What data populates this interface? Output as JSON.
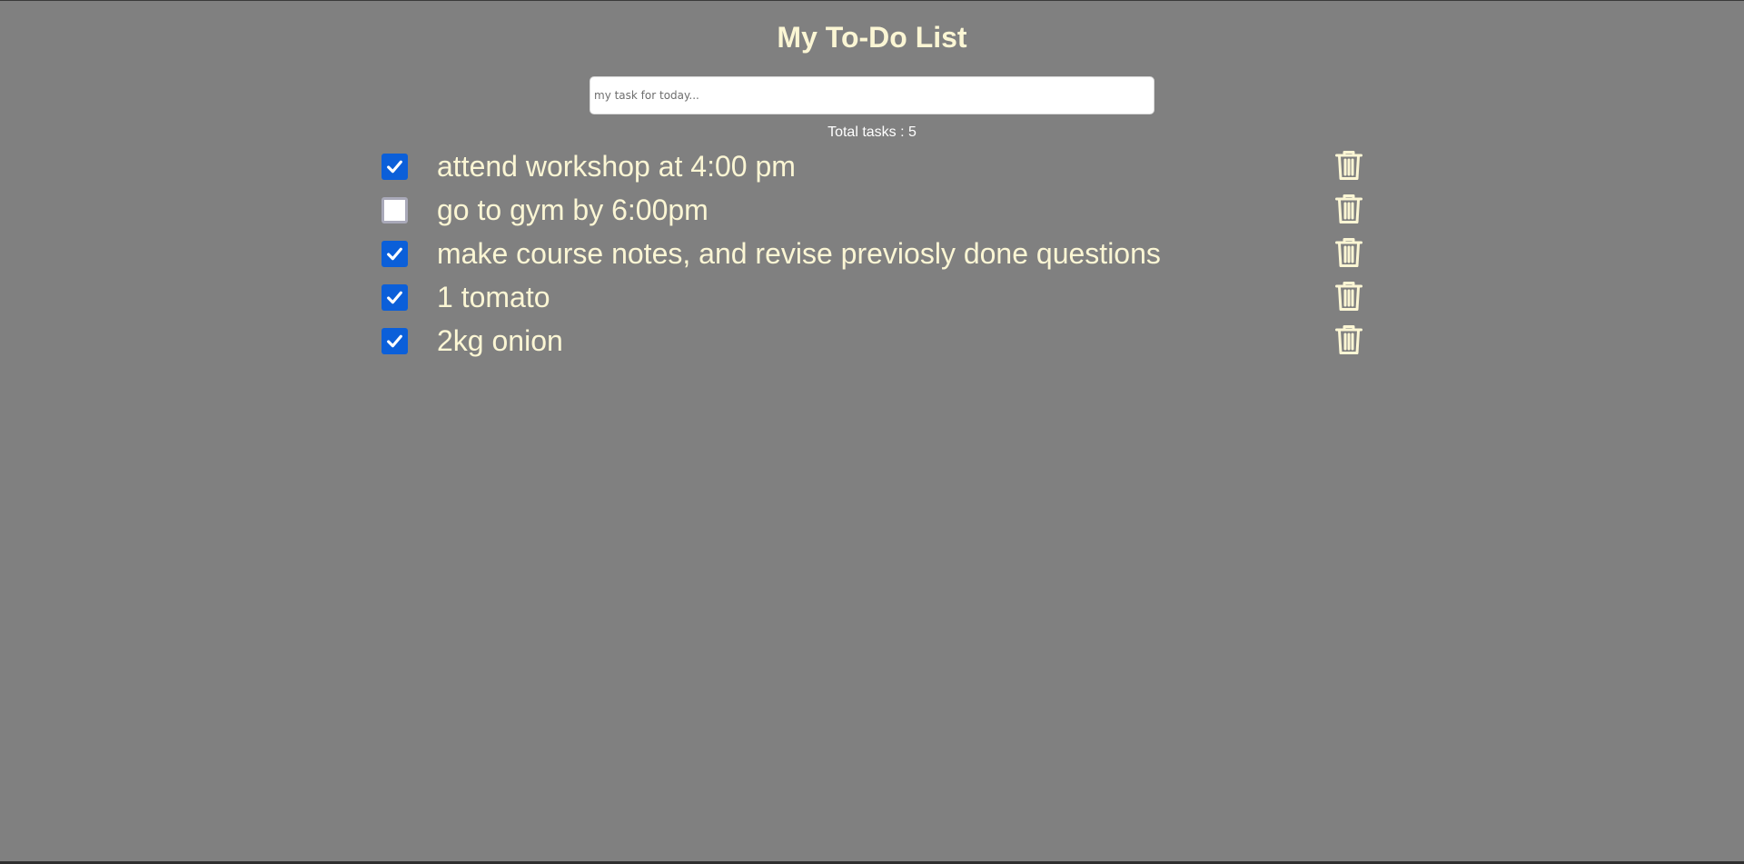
{
  "header": {
    "title": "My To-Do List"
  },
  "task_input": {
    "placeholder": "my task for today...",
    "value": ""
  },
  "summary": {
    "total_label": "Total tasks : 5"
  },
  "tasks": [
    {
      "text": "attend workshop at 4:00 pm",
      "checked": true
    },
    {
      "text": "go to gym by 6:00pm",
      "checked": false
    },
    {
      "text": "make course notes, and revise previosly done questions",
      "checked": true
    },
    {
      "text": "1 tomato",
      "checked": true
    },
    {
      "text": "2kg onion",
      "checked": true
    }
  ],
  "icons": {
    "delete": "trash-icon",
    "checkmark": "checkmark-icon"
  },
  "colors": {
    "background": "#808080",
    "text": "#fbf6d4",
    "checkbox_checked": "#0b5fd9",
    "checkbox_unchecked_border": "#a9a9b9"
  }
}
